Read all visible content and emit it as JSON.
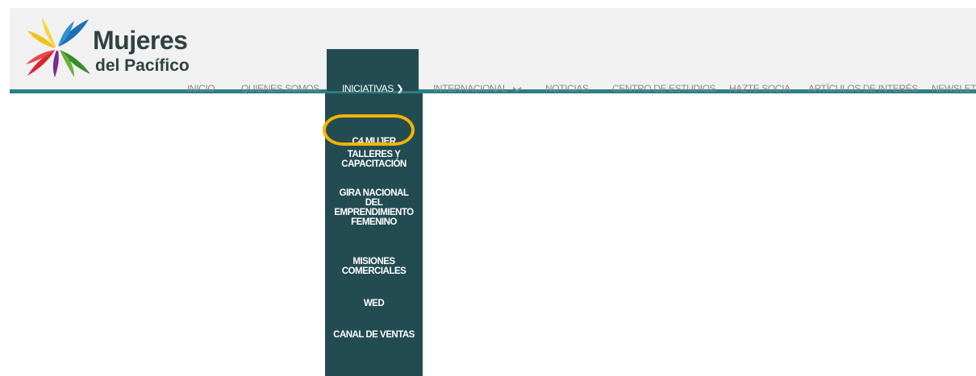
{
  "logo": {
    "line1": "Mujeres",
    "line2": "del Pacífico"
  },
  "nav": {
    "items": [
      {
        "label": "INICIO"
      },
      {
        "label": "QUIENES SOMOS"
      },
      {
        "label": "INICIATIVAS",
        "active": true
      },
      {
        "label": "INTERNACIONAL"
      },
      {
        "label": "NOTICIAS"
      },
      {
        "label": "CENTRO DE ESTUDIOS"
      },
      {
        "label": "HAZTE SOCIA"
      },
      {
        "label": "ARTÍCULOS DE INTERÉS"
      },
      {
        "label": "NEWSLETTI"
      }
    ]
  },
  "dropdown": {
    "items": [
      {
        "line1": "C4 MUJER",
        "line2": "",
        "line3": "",
        "line4": ""
      },
      {
        "line1": "TALLERES Y",
        "line2": "CAPACITACIÓN",
        "line3": "",
        "line4": ""
      },
      {
        "line1": "GIRA NACIONAL",
        "line2": "DEL",
        "line3": "EMPRENDIMIENTO",
        "line4": "FEMENINO"
      },
      {
        "line1": "MISIONES",
        "line2": "COMERCIALES",
        "line3": "",
        "line4": ""
      },
      {
        "line1": "WED",
        "line2": "",
        "line3": "",
        "line4": ""
      },
      {
        "line1": "CANAL DE VENTAS",
        "line2": "",
        "line3": "",
        "line4": ""
      }
    ]
  },
  "colors": {
    "header_bg": "#f1f1f1",
    "accent_teal": "#2c7f85",
    "menu_bg": "#234c52",
    "highlight": "#f3b400",
    "nav_text": "#8a8a8a"
  },
  "icons": {
    "chevron": "chevron-down-icon",
    "logo_mark": "flower-pinwheel-icon"
  }
}
